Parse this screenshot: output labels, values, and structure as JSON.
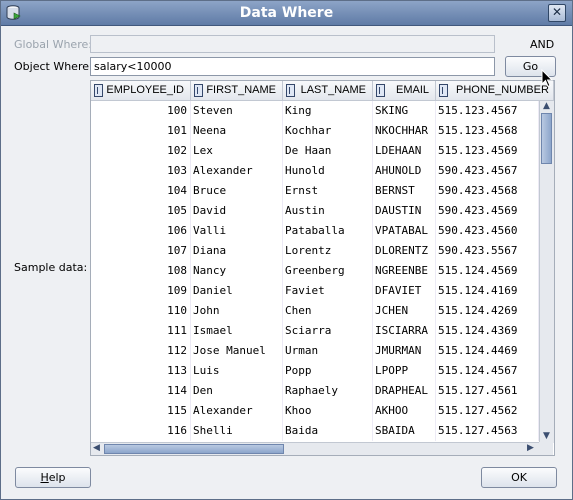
{
  "window": {
    "title": "Data Where",
    "close_glyph": "✕"
  },
  "form": {
    "global_where_label": "Global Where:",
    "global_where_value": "",
    "and_label": "AND",
    "object_where_label": "Object Where:",
    "object_where_value": "salary<10000",
    "go_label": "Go",
    "sample_data_label": "Sample data:"
  },
  "table": {
    "columns": [
      "EMPLOYEE_ID",
      "FIRST_NAME",
      "LAST_NAME",
      "EMAIL",
      "PHONE_NUMBER"
    ],
    "rows": [
      [
        "100",
        "Steven",
        "King",
        "SKING",
        "515.123.4567"
      ],
      [
        "101",
        "Neena",
        "Kochhar",
        "NKOCHHAR",
        "515.123.4568"
      ],
      [
        "102",
        "Lex",
        "De Haan",
        "LDEHAAN",
        "515.123.4569"
      ],
      [
        "103",
        "Alexander",
        "Hunold",
        "AHUNOLD",
        "590.423.4567"
      ],
      [
        "104",
        "Bruce",
        "Ernst",
        "BERNST",
        "590.423.4568"
      ],
      [
        "105",
        "David",
        "Austin",
        "DAUSTIN",
        "590.423.4569"
      ],
      [
        "106",
        "Valli",
        "Pataballa",
        "VPATABAL",
        "590.423.4560"
      ],
      [
        "107",
        "Diana",
        "Lorentz",
        "DLORENTZ",
        "590.423.5567"
      ],
      [
        "108",
        "Nancy",
        "Greenberg",
        "NGREENBE",
        "515.124.4569"
      ],
      [
        "109",
        "Daniel",
        "Faviet",
        "DFAVIET",
        "515.124.4169"
      ],
      [
        "110",
        "John",
        "Chen",
        "JCHEN",
        "515.124.4269"
      ],
      [
        "111",
        "Ismael",
        "Sciarra",
        "ISCIARRA",
        "515.124.4369"
      ],
      [
        "112",
        "Jose Manuel",
        "Urman",
        "JMURMAN",
        "515.124.4469"
      ],
      [
        "113",
        "Luis",
        "Popp",
        "LPOPP",
        "515.124.4567"
      ],
      [
        "114",
        "Den",
        "Raphaely",
        "DRAPHEAL",
        "515.127.4561"
      ],
      [
        "115",
        "Alexander",
        "Khoo",
        "AKHOO",
        "515.127.4562"
      ],
      [
        "116",
        "Shelli",
        "Baida",
        "SBAIDA",
        "515.127.4563"
      ]
    ]
  },
  "buttons": {
    "help_mnemonic": "H",
    "help_rest": "elp",
    "ok_label": "OK"
  },
  "colors": {
    "titlebar": "#6f8ab3",
    "row_background": "#ffffff",
    "grid_line": "#eceaf5"
  },
  "icons": [
    "app-icon",
    "close-icon",
    "column-type-icon",
    "scroll-up-icon",
    "scroll-down-icon",
    "scroll-left-icon",
    "scroll-right-icon",
    "mouse-pointer-icon"
  ]
}
